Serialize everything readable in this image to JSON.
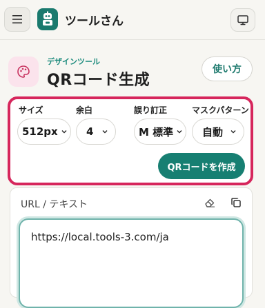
{
  "header": {
    "app_title": "ツールさん",
    "menu_icon": "hamburger-icon",
    "logo_icon": "robot-logo",
    "device_icon": "monitor-icon"
  },
  "tool": {
    "category": "デザインツール",
    "title": "QRコード生成",
    "icon": "palette-icon",
    "usage_label": "使い方"
  },
  "settings": {
    "size": {
      "label": "サイズ",
      "value": "512px"
    },
    "margin": {
      "label": "余白",
      "value": "4"
    },
    "error_correction": {
      "label": "誤り訂正",
      "value": "M 標準"
    },
    "mask_pattern": {
      "label": "マスクパターン",
      "value": "自動"
    },
    "generate_label": "QRコードを作成"
  },
  "input": {
    "label": "URL / テキスト",
    "value": "https://local.tools-3.com/ja"
  },
  "colors": {
    "accent": "#177f72",
    "highlight": "#d6265c",
    "background": "#f7f6f2"
  }
}
